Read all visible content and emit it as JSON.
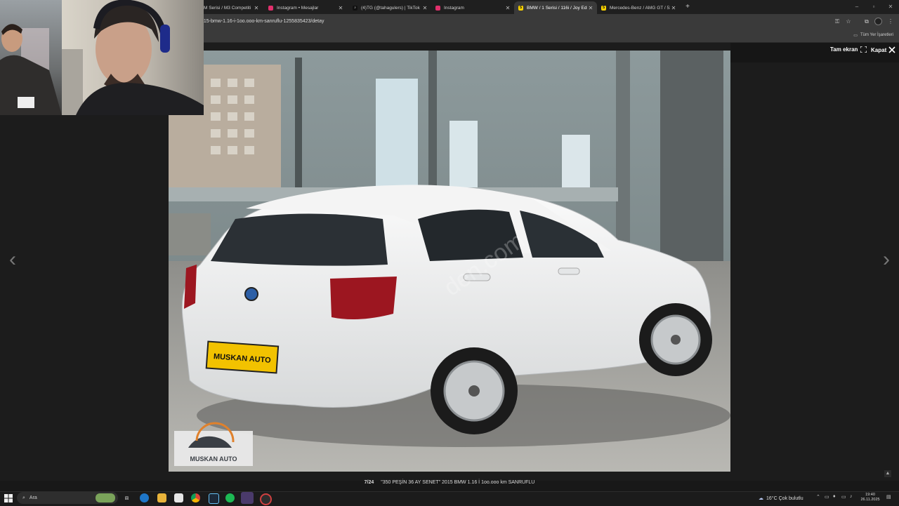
{
  "browser": {
    "tabs": [
      {
        "title": "M Serisi / M3 Competiti",
        "favicon": "sahibinden-icon",
        "active": false
      },
      {
        "title": "Instagram • Mesajlar",
        "favicon": "instagram-icon",
        "active": false
      },
      {
        "title": "(4)TG (@tahagulers) | TikTok",
        "favicon": "tiktok-icon",
        "active": false
      },
      {
        "title": "Instagram",
        "favicon": "instagram-icon",
        "active": false
      },
      {
        "title": "BMW / 1 Serisi / 116i / Joy Edit",
        "favicon": "sahibinden-icon",
        "active": true
      },
      {
        "title": "Mercedes-Benz / AMG GT / 53",
        "favicon": "sahibinden-icon",
        "active": false
      }
    ],
    "url": "015-bmw-1.16-i-1oo.ooo-km-sanruflu-1255835423/detay",
    "all_bookmarks": "Tüm Yer İşaretleri"
  },
  "gallery": {
    "fullscreen_label": "Tam ekran",
    "close_label": "Kapat",
    "counter": "7/24",
    "caption": "\"350 PEŞİN 36 AY SENET\" 2015 BMW 1.16 İ 1oo.ooo km SANRUFLU",
    "plate_text": "MUSKAN AUTO",
    "watermark_text": "den.com",
    "logo_text": "MUSKAN AUTO"
  },
  "taskbar": {
    "search_placeholder": "Ara",
    "weather": "16°C  Çok bulutlu",
    "time": "19:40",
    "date": "26.11.2025"
  },
  "colors": {
    "sahibinden": "#ffd400",
    "instagram": "#e1306c",
    "plate": "#f2c200"
  }
}
